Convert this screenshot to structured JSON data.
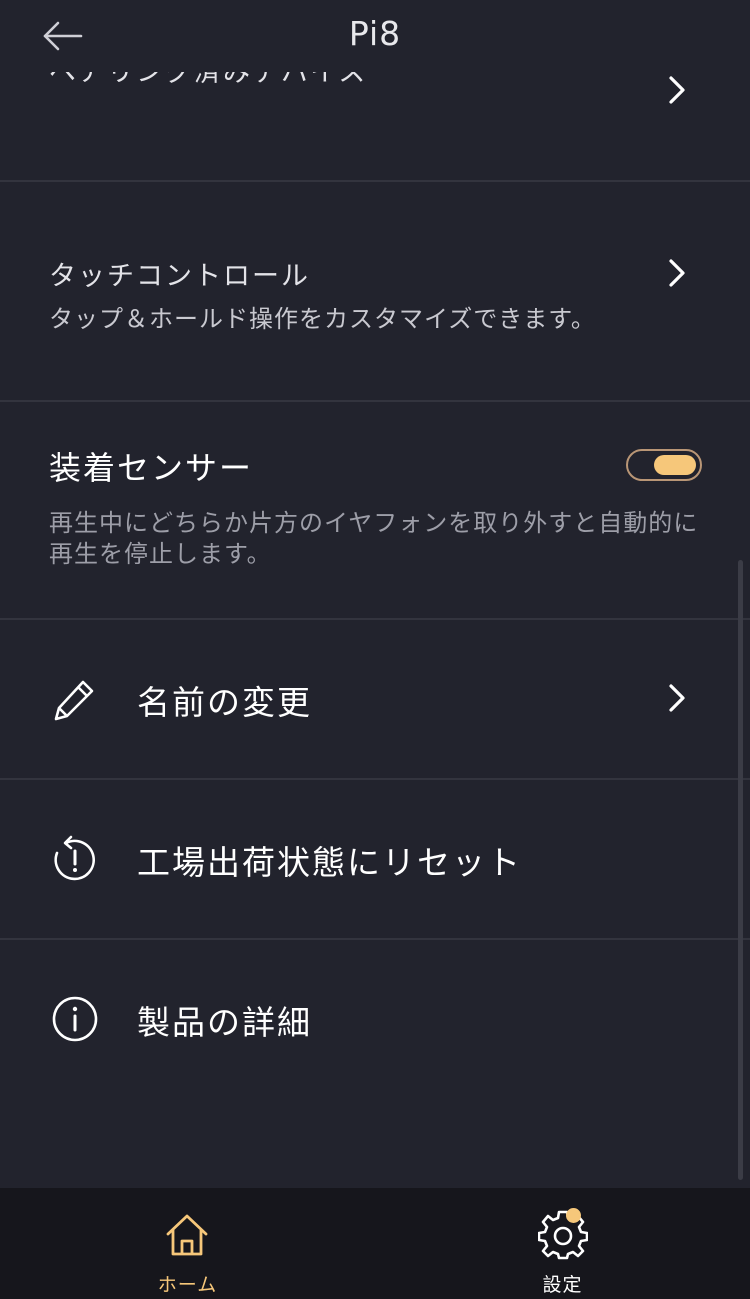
{
  "header": {
    "title": "Pi8"
  },
  "paired_devices": {
    "label": "ペアリング済みデバイス"
  },
  "touch_control": {
    "title": "タッチコントロール",
    "description": "タップ＆ホールド操作をカスタマイズできます。"
  },
  "wear_sensor": {
    "title": "装着センサー",
    "description": "再生中にどちらか片方のイヤフォンを取り外すと自動的に再生を停止します。",
    "enabled": true
  },
  "menu": {
    "rename": {
      "label": "名前の変更",
      "icon": "pencil-icon"
    },
    "factory_reset": {
      "label": "工場出荷状態にリセット",
      "icon": "reset-icon"
    },
    "product_details": {
      "label": "製品の詳細",
      "icon": "info-icon"
    }
  },
  "tabs": {
    "home": {
      "label": "ホーム",
      "icon": "home-icon",
      "active": true
    },
    "settings": {
      "label": "設定",
      "icon": "gear-icon",
      "active": false,
      "badge": true
    }
  },
  "colors": {
    "background": "#22232d",
    "tabbar": "#16161c",
    "accent": "#f6c77a",
    "divider": "#33343e"
  }
}
